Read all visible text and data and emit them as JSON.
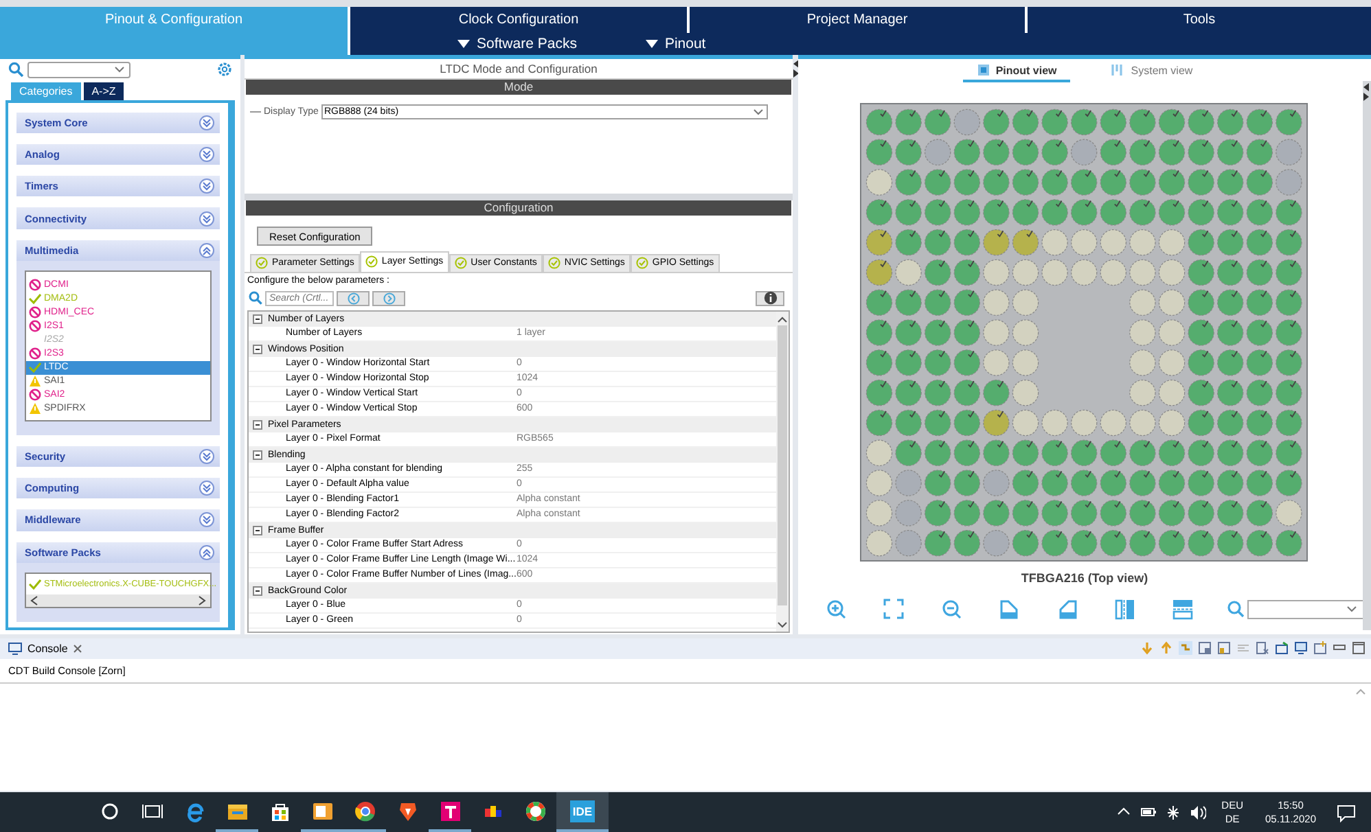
{
  "main_tabs": [
    {
      "label": "Pinout & Configuration",
      "selected": true
    },
    {
      "label": "Clock Configuration",
      "selected": false
    },
    {
      "label": "Project Manager",
      "selected": false
    },
    {
      "label": "Tools",
      "selected": false
    }
  ],
  "sub_menus": [
    {
      "label": "Software Packs"
    },
    {
      "label": "Pinout"
    }
  ],
  "sidebar": {
    "view_tabs": [
      {
        "label": "Categories",
        "selected": true
      },
      {
        "label": "A->Z",
        "selected": false
      }
    ],
    "categories": [
      {
        "label": "System Core",
        "expanded": false
      },
      {
        "label": "Analog",
        "expanded": false
      },
      {
        "label": "Timers",
        "expanded": false
      },
      {
        "label": "Connectivity",
        "expanded": false
      },
      {
        "label": "Multimedia",
        "expanded": true,
        "items": [
          {
            "label": "DCMI",
            "kind": "blocked",
            "selected": false
          },
          {
            "label": "DMA2D",
            "kind": "ok",
            "selected": false
          },
          {
            "label": "HDMI_CEC",
            "kind": "blocked",
            "selected": false
          },
          {
            "label": "I2S1",
            "kind": "blocked",
            "selected": false
          },
          {
            "label": "I2S2",
            "kind": "unavailable",
            "selected": false
          },
          {
            "label": "I2S3",
            "kind": "blocked",
            "selected": false
          },
          {
            "label": "LTDC",
            "kind": "ok",
            "selected": true
          },
          {
            "label": "SAI1",
            "kind": "warning",
            "selected": false
          },
          {
            "label": "SAI2",
            "kind": "blocked",
            "selected": false
          },
          {
            "label": "SPDIFRX",
            "kind": "warning",
            "selected": false
          }
        ]
      },
      {
        "label": "Security",
        "expanded": false
      },
      {
        "label": "Computing",
        "expanded": false
      },
      {
        "label": "Middleware",
        "expanded": false
      },
      {
        "label": "Software Packs",
        "expanded": true,
        "items": [
          {
            "label": "STMicroelectronics.X-CUBE-TOUCHGFX...",
            "kind": "ok",
            "selected": false
          }
        ]
      }
    ]
  },
  "mode_panel": {
    "title": "LTDC Mode and Configuration",
    "heading": "Mode",
    "display_type": {
      "label": "Display Type",
      "value": "RGB888 (24 bits)"
    }
  },
  "config_panel": {
    "heading": "Configuration",
    "reset_button": "Reset Configuration",
    "tabs": [
      {
        "label": "Parameter Settings",
        "selected": false
      },
      {
        "label": "Layer Settings",
        "selected": true
      },
      {
        "label": "User Constants",
        "selected": false
      },
      {
        "label": "NVIC Settings",
        "selected": false
      },
      {
        "label": "GPIO Settings",
        "selected": false
      }
    ],
    "hint": "Configure the below parameters :",
    "search": {
      "placeholder": "Search (Crtl..."
    },
    "groups": [
      {
        "name": "Number of Layers",
        "expanded": true,
        "params": [
          {
            "name": "Number of Layers",
            "value": "1 layer"
          }
        ]
      },
      {
        "name": "Windows Position",
        "expanded": true,
        "params": [
          {
            "name": "Layer 0 - Window Horizontal Start",
            "value": "0"
          },
          {
            "name": "Layer 0 - Window Horizontal Stop",
            "value": "1024"
          },
          {
            "name": "Layer 0 - Window Vertical Start",
            "value": "0"
          },
          {
            "name": "Layer 0 - Window Vertical Stop",
            "value": "600"
          }
        ]
      },
      {
        "name": "Pixel Parameters",
        "expanded": true,
        "params": [
          {
            "name": "Layer 0 - Pixel Format",
            "value": "RGB565"
          }
        ]
      },
      {
        "name": "Blending",
        "expanded": true,
        "params": [
          {
            "name": "Layer 0 - Alpha constant for blending",
            "value": "255"
          },
          {
            "name": "Layer 0 - Default Alpha value",
            "value": "0"
          },
          {
            "name": "Layer 0 - Blending Factor1",
            "value": "Alpha constant"
          },
          {
            "name": "Layer 0 - Blending Factor2",
            "value": "Alpha constant"
          }
        ]
      },
      {
        "name": "Frame Buffer",
        "expanded": true,
        "params": [
          {
            "name": "Layer 0 - Color Frame Buffer Start Adress",
            "value": "0"
          },
          {
            "name": "Layer 0 - Color Frame Buffer Line Length (Image Wi...",
            "value": "1024"
          },
          {
            "name": "Layer 0 - Color Frame Buffer Number of Lines (Imag...",
            "value": "600"
          }
        ]
      },
      {
        "name": "BackGround Color",
        "expanded": true,
        "params": [
          {
            "name": "Layer 0 - Blue",
            "value": "0"
          },
          {
            "name": "Layer 0 - Green",
            "value": "0"
          }
        ]
      }
    ]
  },
  "pinout": {
    "view_tabs": [
      {
        "label": "Pinout view",
        "selected": true
      },
      {
        "label": "System view",
        "selected": false
      }
    ],
    "pin_rows": [
      {
        "pins": [
          {
            "kind": "used"
          },
          {
            "kind": "used"
          },
          {
            "kind": "used"
          },
          {
            "kind": "free"
          },
          {
            "kind": "used"
          },
          {
            "kind": "used"
          },
          {
            "kind": "used"
          },
          {
            "kind": "used"
          },
          {
            "kind": "used"
          },
          {
            "kind": "used"
          },
          {
            "kind": "used"
          },
          {
            "kind": "used"
          },
          {
            "kind": "used"
          },
          {
            "kind": "used"
          },
          {
            "kind": "used"
          }
        ]
      },
      {
        "pins": [
          {
            "kind": "used"
          },
          {
            "kind": "used"
          },
          {
            "kind": "free"
          },
          {
            "kind": "used"
          },
          {
            "kind": "used"
          },
          {
            "kind": "used"
          },
          {
            "kind": "used"
          },
          {
            "kind": "free"
          },
          {
            "kind": "used"
          },
          {
            "kind": "used"
          },
          {
            "kind": "used"
          },
          {
            "kind": "used"
          },
          {
            "kind": "used"
          },
          {
            "kind": "used"
          },
          {
            "kind": "free"
          }
        ]
      },
      {
        "pins": [
          {
            "kind": "power"
          },
          {
            "kind": "used"
          },
          {
            "kind": "used"
          },
          {
            "kind": "used"
          },
          {
            "kind": "used"
          },
          {
            "kind": "used"
          },
          {
            "kind": "used"
          },
          {
            "kind": "used"
          },
          {
            "kind": "used"
          },
          {
            "kind": "used"
          },
          {
            "kind": "used"
          },
          {
            "kind": "used"
          },
          {
            "kind": "used"
          },
          {
            "kind": "used"
          },
          {
            "kind": "free"
          }
        ]
      },
      {
        "pins": [
          {
            "kind": "used"
          },
          {
            "kind": "used"
          },
          {
            "kind": "used"
          },
          {
            "kind": "used"
          },
          {
            "kind": "used"
          },
          {
            "kind": "used"
          },
          {
            "kind": "used"
          },
          {
            "kind": "used"
          },
          {
            "kind": "used"
          },
          {
            "kind": "used"
          },
          {
            "kind": "used"
          },
          {
            "kind": "used"
          },
          {
            "kind": "used"
          },
          {
            "kind": "used"
          },
          {
            "kind": "used"
          }
        ]
      },
      {
        "pins": [
          {
            "kind": "warn"
          },
          {
            "kind": "used"
          },
          {
            "kind": "used"
          },
          {
            "kind": "used"
          },
          {
            "kind": "warn"
          },
          {
            "kind": "warn"
          },
          {
            "kind": "power"
          },
          {
            "kind": "power"
          },
          {
            "kind": "power"
          },
          {
            "kind": "power"
          },
          {
            "kind": "power"
          },
          {
            "kind": "used"
          },
          {
            "kind": "used"
          },
          {
            "kind": "used"
          },
          {
            "kind": "used"
          }
        ]
      },
      {
        "pins": [
          {
            "kind": "warn"
          },
          {
            "kind": "power"
          },
          {
            "kind": "used"
          },
          {
            "kind": "used"
          },
          {
            "kind": "power"
          },
          {
            "kind": "power"
          },
          {
            "kind": "power"
          },
          {
            "kind": "power"
          },
          {
            "kind": "power"
          },
          {
            "kind": "power"
          },
          {
            "kind": "power"
          },
          {
            "kind": "used"
          },
          {
            "kind": "used"
          },
          {
            "kind": "used"
          },
          {
            "kind": "used"
          }
        ]
      },
      {
        "pins": [
          {
            "kind": "used"
          },
          {
            "kind": "used"
          },
          {
            "kind": "used"
          },
          {
            "kind": "used"
          },
          {
            "kind": "power"
          },
          {
            "kind": "power"
          },
          {
            "kind": "gap"
          },
          {
            "kind": "gap"
          },
          {
            "kind": "gap"
          },
          {
            "kind": "power"
          },
          {
            "kind": "power"
          },
          {
            "kind": "used"
          },
          {
            "kind": "used"
          },
          {
            "kind": "used"
          },
          {
            "kind": "used"
          }
        ]
      },
      {
        "pins": [
          {
            "kind": "used"
          },
          {
            "kind": "used"
          },
          {
            "kind": "used"
          },
          {
            "kind": "used"
          },
          {
            "kind": "power"
          },
          {
            "kind": "power"
          },
          {
            "kind": "gap"
          },
          {
            "kind": "gap"
          },
          {
            "kind": "gap"
          },
          {
            "kind": "power"
          },
          {
            "kind": "power"
          },
          {
            "kind": "used"
          },
          {
            "kind": "used"
          },
          {
            "kind": "used"
          },
          {
            "kind": "used"
          }
        ]
      },
      {
        "pins": [
          {
            "kind": "used"
          },
          {
            "kind": "used"
          },
          {
            "kind": "used"
          },
          {
            "kind": "used"
          },
          {
            "kind": "power"
          },
          {
            "kind": "power"
          },
          {
            "kind": "gap"
          },
          {
            "kind": "gap"
          },
          {
            "kind": "gap"
          },
          {
            "kind": "power"
          },
          {
            "kind": "power"
          },
          {
            "kind": "used"
          },
          {
            "kind": "used"
          },
          {
            "kind": "used"
          },
          {
            "kind": "used"
          }
        ]
      },
      {
        "pins": [
          {
            "kind": "used"
          },
          {
            "kind": "used"
          },
          {
            "kind": "used"
          },
          {
            "kind": "used"
          },
          {
            "kind": "used"
          },
          {
            "kind": "power"
          },
          {
            "kind": "gap"
          },
          {
            "kind": "gap"
          },
          {
            "kind": "gap"
          },
          {
            "kind": "power"
          },
          {
            "kind": "power"
          },
          {
            "kind": "used"
          },
          {
            "kind": "used"
          },
          {
            "kind": "used"
          },
          {
            "kind": "used"
          }
        ]
      },
      {
        "pins": [
          {
            "kind": "used"
          },
          {
            "kind": "used"
          },
          {
            "kind": "used"
          },
          {
            "kind": "used"
          },
          {
            "kind": "warn"
          },
          {
            "kind": "power"
          },
          {
            "kind": "power"
          },
          {
            "kind": "power"
          },
          {
            "kind": "power"
          },
          {
            "kind": "power"
          },
          {
            "kind": "power"
          },
          {
            "kind": "used"
          },
          {
            "kind": "used"
          },
          {
            "kind": "used"
          },
          {
            "kind": "used"
          }
        ]
      },
      {
        "pins": [
          {
            "kind": "power"
          },
          {
            "kind": "used"
          },
          {
            "kind": "used"
          },
          {
            "kind": "used"
          },
          {
            "kind": "used"
          },
          {
            "kind": "used"
          },
          {
            "kind": "used"
          },
          {
            "kind": "used"
          },
          {
            "kind": "used"
          },
          {
            "kind": "used"
          },
          {
            "kind": "used"
          },
          {
            "kind": "used"
          },
          {
            "kind": "used"
          },
          {
            "kind": "used"
          },
          {
            "kind": "used"
          }
        ]
      },
      {
        "pins": [
          {
            "kind": "power"
          },
          {
            "kind": "free"
          },
          {
            "kind": "used"
          },
          {
            "kind": "used"
          },
          {
            "kind": "free"
          },
          {
            "kind": "used"
          },
          {
            "kind": "used"
          },
          {
            "kind": "used"
          },
          {
            "kind": "used"
          },
          {
            "kind": "used"
          },
          {
            "kind": "used"
          },
          {
            "kind": "used"
          },
          {
            "kind": "used"
          },
          {
            "kind": "used"
          },
          {
            "kind": "used"
          }
        ]
      },
      {
        "pins": [
          {
            "kind": "power"
          },
          {
            "kind": "free"
          },
          {
            "kind": "used"
          },
          {
            "kind": "used"
          },
          {
            "kind": "used"
          },
          {
            "kind": "used"
          },
          {
            "kind": "used"
          },
          {
            "kind": "used"
          },
          {
            "kind": "used"
          },
          {
            "kind": "used"
          },
          {
            "kind": "used"
          },
          {
            "kind": "used"
          },
          {
            "kind": "used"
          },
          {
            "kind": "used"
          },
          {
            "kind": "power"
          }
        ]
      },
      {
        "pins": [
          {
            "kind": "power"
          },
          {
            "kind": "free"
          },
          {
            "kind": "used"
          },
          {
            "kind": "used"
          },
          {
            "kind": "free"
          },
          {
            "kind": "used"
          },
          {
            "kind": "used"
          },
          {
            "kind": "used"
          },
          {
            "kind": "used"
          },
          {
            "kind": "used"
          },
          {
            "kind": "used"
          },
          {
            "kind": "used"
          },
          {
            "kind": "used"
          },
          {
            "kind": "used"
          },
          {
            "kind": "used"
          }
        ]
      }
    ],
    "caption": "TFBGA216 (Top view)"
  },
  "console": {
    "title": "Console",
    "line": "CDT Build Console [Zorn]"
  },
  "taskbar": {
    "app_label": "IDE",
    "language": "DEU",
    "layout": "DE",
    "time": "15:50",
    "date": "05.11.2020"
  }
}
